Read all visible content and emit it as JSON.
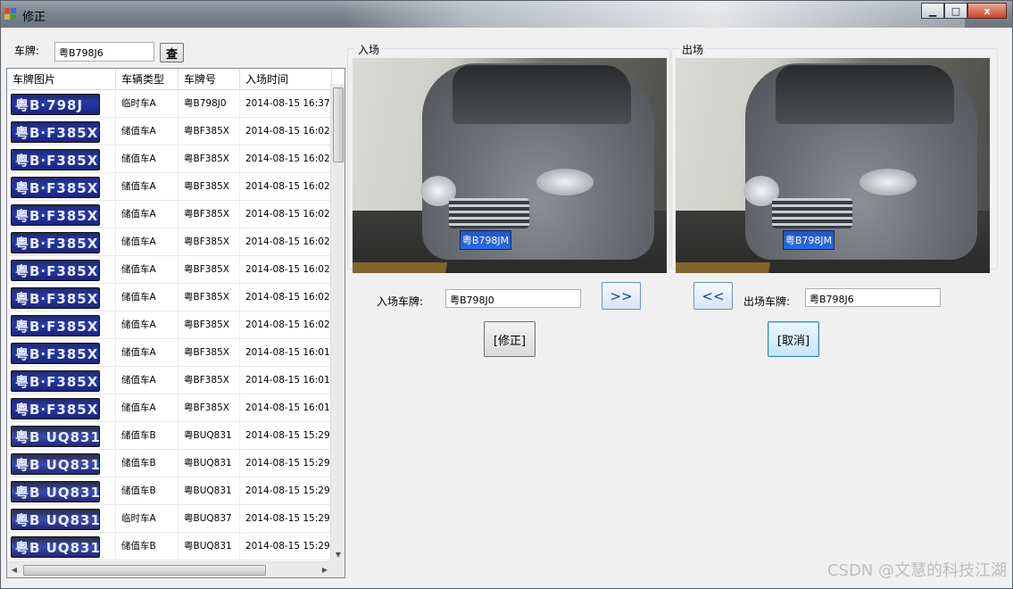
{
  "window": {
    "title": "修正",
    "minimize": "▁",
    "maximize": "□",
    "close": "x"
  },
  "search": {
    "label": "车牌:",
    "value": "粤B798J6",
    "button": "查"
  },
  "grid": {
    "columns": [
      "车牌图片",
      "车辆类型",
      "车牌号",
      "入场时间"
    ],
    "rows": [
      {
        "plate_image": "粤B·798J",
        "type": "临时车A",
        "number": "粤B798J0",
        "time": "2014-08-15 16:37"
      },
      {
        "plate_image": "粤B·F385X",
        "type": "储值车A",
        "number": "粤BF385X",
        "time": "2014-08-15 16:02"
      },
      {
        "plate_image": "粤B·F385X",
        "type": "储值车A",
        "number": "粤BF385X",
        "time": "2014-08-15 16:02"
      },
      {
        "plate_image": "粤B·F385X",
        "type": "储值车A",
        "number": "粤BF385X",
        "time": "2014-08-15 16:02"
      },
      {
        "plate_image": "粤B·F385X",
        "type": "储值车A",
        "number": "粤BF385X",
        "time": "2014-08-15 16:02"
      },
      {
        "plate_image": "粤B·F385X",
        "type": "储值车A",
        "number": "粤BF385X",
        "time": "2014-08-15 16:02"
      },
      {
        "plate_image": "粤B·F385X",
        "type": "储值车A",
        "number": "粤BF385X",
        "time": "2014-08-15 16:02"
      },
      {
        "plate_image": "粤B·F385X",
        "type": "储值车A",
        "number": "粤BF385X",
        "time": "2014-08-15 16:02"
      },
      {
        "plate_image": "粤B·F385X",
        "type": "储值车A",
        "number": "粤BF385X",
        "time": "2014-08-15 16:02"
      },
      {
        "plate_image": "粤B·F385X",
        "type": "储值车A",
        "number": "粤BF385X",
        "time": "2014-08-15 16:01"
      },
      {
        "plate_image": "粤B·F385X",
        "type": "储值车A",
        "number": "粤BF385X",
        "time": "2014-08-15 16:01"
      },
      {
        "plate_image": "粤B·F385X",
        "type": "储值车A",
        "number": "粤BF385X",
        "time": "2014-08-15 16:01"
      },
      {
        "plate_image": "粤B UQ831",
        "type": "储值车B",
        "number": "粤BUQ831",
        "time": "2014-08-15 15:29"
      },
      {
        "plate_image": "粤B UQ831",
        "type": "储值车B",
        "number": "粤BUQ831",
        "time": "2014-08-15 15:29"
      },
      {
        "plate_image": "粤B UQ831",
        "type": "储值车B",
        "number": "粤BUQ831",
        "time": "2014-08-15 15:29"
      },
      {
        "plate_image": "粤B UQ831",
        "type": "临时车A",
        "number": "粤BUQ837",
        "time": "2014-08-15 15:29"
      },
      {
        "plate_image": "粤B UQ831",
        "type": "储值车B",
        "number": "粤BUQ831",
        "time": "2014-08-15 15:29"
      }
    ]
  },
  "entry": {
    "group_label": "入场",
    "photo_plate": "粤B798JM",
    "plate_label": "入场车牌:",
    "plate_value": "粤B798J0",
    "nav_button": ">>",
    "action_button": "[修正]"
  },
  "exit": {
    "group_label": "出场",
    "photo_plate": "粤B798JM",
    "plate_label": "出场车牌:",
    "plate_value": "粤B798J6",
    "nav_button": "<<",
    "action_button": "[取消]"
  },
  "watermark": "CSDN @文慧的科技江湖"
}
